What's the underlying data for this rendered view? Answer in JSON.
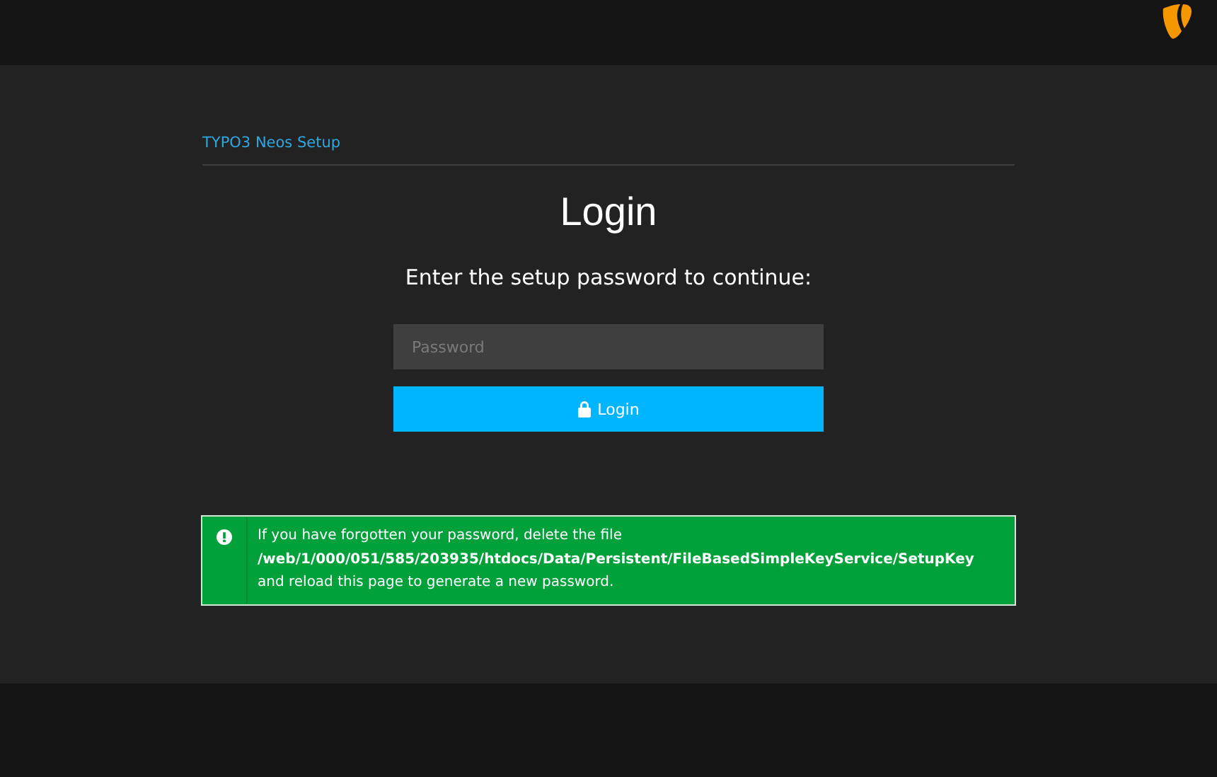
{
  "header": {
    "breadcrumb": "TYPO3 Neos Setup"
  },
  "title": "Login",
  "prompt": "Enter the setup password to continue:",
  "password_field": {
    "placeholder": "Password"
  },
  "login_button": {
    "label": "Login"
  },
  "notice": {
    "message": "If you have forgotten your password, delete the file **/web/1/000/051/585/203935/htdocs/Data/Persistent/FileBasedSimpleKeyService/SetupKey** and reload this page to generate a new password."
  }
}
